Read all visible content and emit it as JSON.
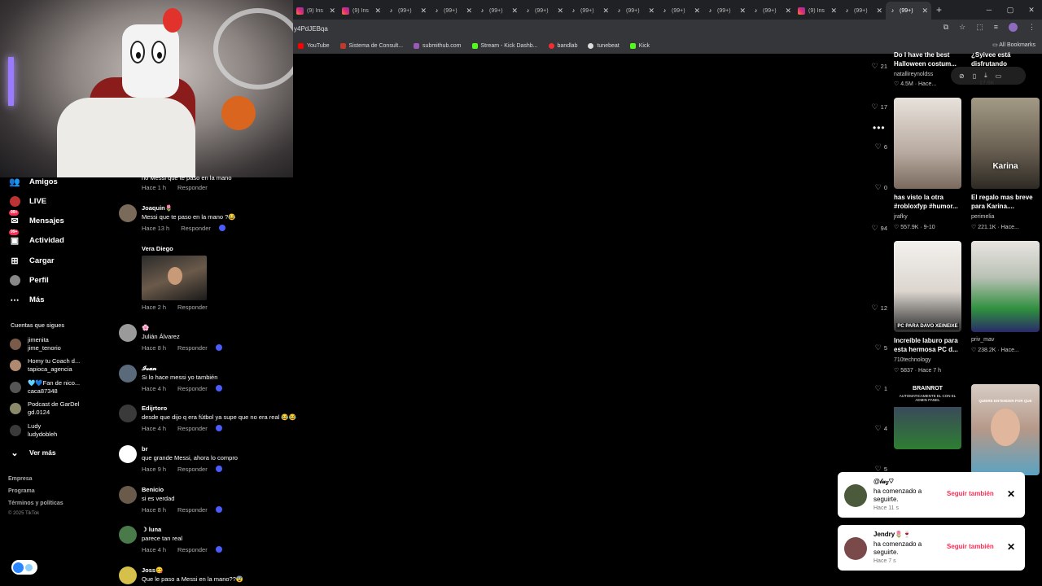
{
  "browser": {
    "tabs": [
      {
        "icon": "instagram-icon",
        "label": "(9) Ins"
      },
      {
        "icon": "instagram-icon",
        "label": "(9) Ins"
      },
      {
        "icon": "tiktok-icon",
        "label": "(99+)"
      },
      {
        "icon": "tiktok-icon",
        "label": "(99+)"
      },
      {
        "icon": "tiktok-icon",
        "label": "(99+)"
      },
      {
        "icon": "tiktok-icon",
        "label": "(99+)"
      },
      {
        "icon": "tiktok-icon",
        "label": "(99+)"
      },
      {
        "icon": "tiktok-icon",
        "label": "(99+)"
      },
      {
        "icon": "tiktok-icon",
        "label": "(99+)"
      },
      {
        "icon": "tiktok-icon",
        "label": "(99+)"
      },
      {
        "icon": "tiktok-icon",
        "label": "(99+)"
      },
      {
        "icon": "instagram-icon",
        "label": "(9) Ins"
      },
      {
        "icon": "tiktok-icon",
        "label": "(99+)"
      },
      {
        "icon": "tiktok-icon",
        "label": "(99+)"
      }
    ],
    "url": "y4PdJEBqa",
    "bookmarks": [
      {
        "label": "YouTube",
        "color": "#ff0000"
      },
      {
        "label": "Sistema de Consult...",
        "color": "#c0392b"
      },
      {
        "label": "submithub.com",
        "color": "#9b59b6"
      },
      {
        "label": "Stream - Kick Dashb...",
        "color": "#53fc18"
      },
      {
        "label": "bandlab",
        "color": "#f32d2d"
      },
      {
        "label": "tunebeat",
        "color": "#dddddd"
      },
      {
        "label": "Kick",
        "color": "#53fc18"
      }
    ],
    "all_bookmarks": "All Bookmarks"
  },
  "sidebar": {
    "nav": [
      {
        "label": "Amigos",
        "icon": "friends-icon",
        "badge": ""
      },
      {
        "label": "LIVE",
        "icon": "live-icon",
        "badge": ""
      },
      {
        "label": "Mensajes",
        "icon": "messages-icon",
        "badge": "99+"
      },
      {
        "label": "Actividad",
        "icon": "activity-icon",
        "badge": "99+"
      },
      {
        "label": "Cargar",
        "icon": "upload-icon",
        "badge": ""
      },
      {
        "label": "Perfil",
        "icon": "profile-icon",
        "badge": ""
      },
      {
        "label": "Más",
        "icon": "more-icon",
        "badge": ""
      }
    ],
    "following_title": "Cuentas que sigues",
    "following": [
      {
        "name": "jimenita",
        "handle": "jime_tenorio"
      },
      {
        "name": "Homy tu Coach d...",
        "handle": "tapioca_agencia"
      },
      {
        "name": "🩵💙Fan de nico...",
        "handle": "caca87348"
      },
      {
        "name": "Podcast de GarDel",
        "handle": "gd.0124"
      },
      {
        "name": "Ludy",
        "handle": "ludydobleh"
      }
    ],
    "see_more": "Ver más",
    "footer": [
      "Empresa",
      "Programa",
      "Términos y políticas"
    ],
    "copyright": "© 2025 TikTok"
  },
  "comments": [
    {
      "name": "",
      "text": "no Messi que te paso en la mano",
      "time": "Hace 1 h",
      "reply": "Responder"
    },
    {
      "name": "Joaquin🌷",
      "text": "Messi que te paso en la mano ?😂",
      "time": "Hace 13 h",
      "reply": "Responder"
    },
    {
      "name": "Vera Diego",
      "text": "",
      "time": "Hace 2 h",
      "reply": "Responder"
    },
    {
      "name": "🌸",
      "text": "Julián Álvarez",
      "time": "Hace 8 h",
      "reply": "Responder"
    },
    {
      "name": "𝓘𝓿𝓪𝓷",
      "text": "Si lo hace messi yo también",
      "time": "Hace 4 h",
      "reply": "Responder"
    },
    {
      "name": "Edijrtoro",
      "text": "desde que dijo q era fútbol ya supe que no era real 😂😂",
      "time": "Hace 4 h",
      "reply": "Responder"
    },
    {
      "name": "br",
      "text": "que grande Messi, ahora lo compro",
      "time": "Hace 9 h",
      "reply": "Responder"
    },
    {
      "name": "Benicio",
      "text": "si es verdad",
      "time": "Hace 8 h",
      "reply": "Responder"
    },
    {
      "name": "☽ luna",
      "text": "parece tan real",
      "time": "Hace 4 h",
      "reply": "Responder"
    },
    {
      "name": "Joss😋",
      "text": "Que le paso a Messi en la mano??😨",
      "time": "",
      "reply": ""
    }
  ],
  "like_counts": [
    "21",
    "17",
    "6",
    "0",
    "94",
    "12",
    "5",
    "1",
    "4",
    "5"
  ],
  "recommendations": [
    {
      "title": "Do I have the best Halloween costum...",
      "user": "natallireynoldss",
      "stats": "♡ 4.5M · Hace..."
    },
    {
      "title": "¿Syivee está disfrutando",
      "user": "",
      "stats": "17.6K"
    },
    {
      "title": "has visto la otra #robloxfyp #humor...",
      "user": "jrafky",
      "stats": "♡ 557.9K · 9-10",
      "thumb_label": ""
    },
    {
      "title": "El regalo mas breve para Karina....",
      "user": "perimelia",
      "stats": "♡ 221.1K · Hace...",
      "thumb_label": "Karina"
    },
    {
      "title": "Increíble laburo para esta hermosa PC d...",
      "user": "710technology",
      "stats": "♡ 5837 · Hace 7 h",
      "thumb_label": "PC PARA DAVO XEINEIXE"
    },
    {
      "title": "",
      "user": "priv_mav",
      "stats": "♡ 238.2K · Hace..."
    },
    {
      "title": "BRAINROT",
      "subtitle": "AUTOMATICAMENTE EL CON EL ADMIN PANEL"
    },
    {
      "title": "QUIERE ENTENDER POR QUE"
    }
  ],
  "notifications": [
    {
      "name": "@𝓁𝓊𝓏♡",
      "message": "ha comenzado a seguirte.",
      "time": "Hace 11 s",
      "action": "Seguir también"
    },
    {
      "name": "Jendry🌷🍷",
      "message": "ha comenzado a seguirte.",
      "time": "Hace 7 s",
      "action": "Seguir también"
    }
  ],
  "colors": {
    "accent": "#fe2c55",
    "background": "#000000",
    "tab_bg": "#202124"
  }
}
